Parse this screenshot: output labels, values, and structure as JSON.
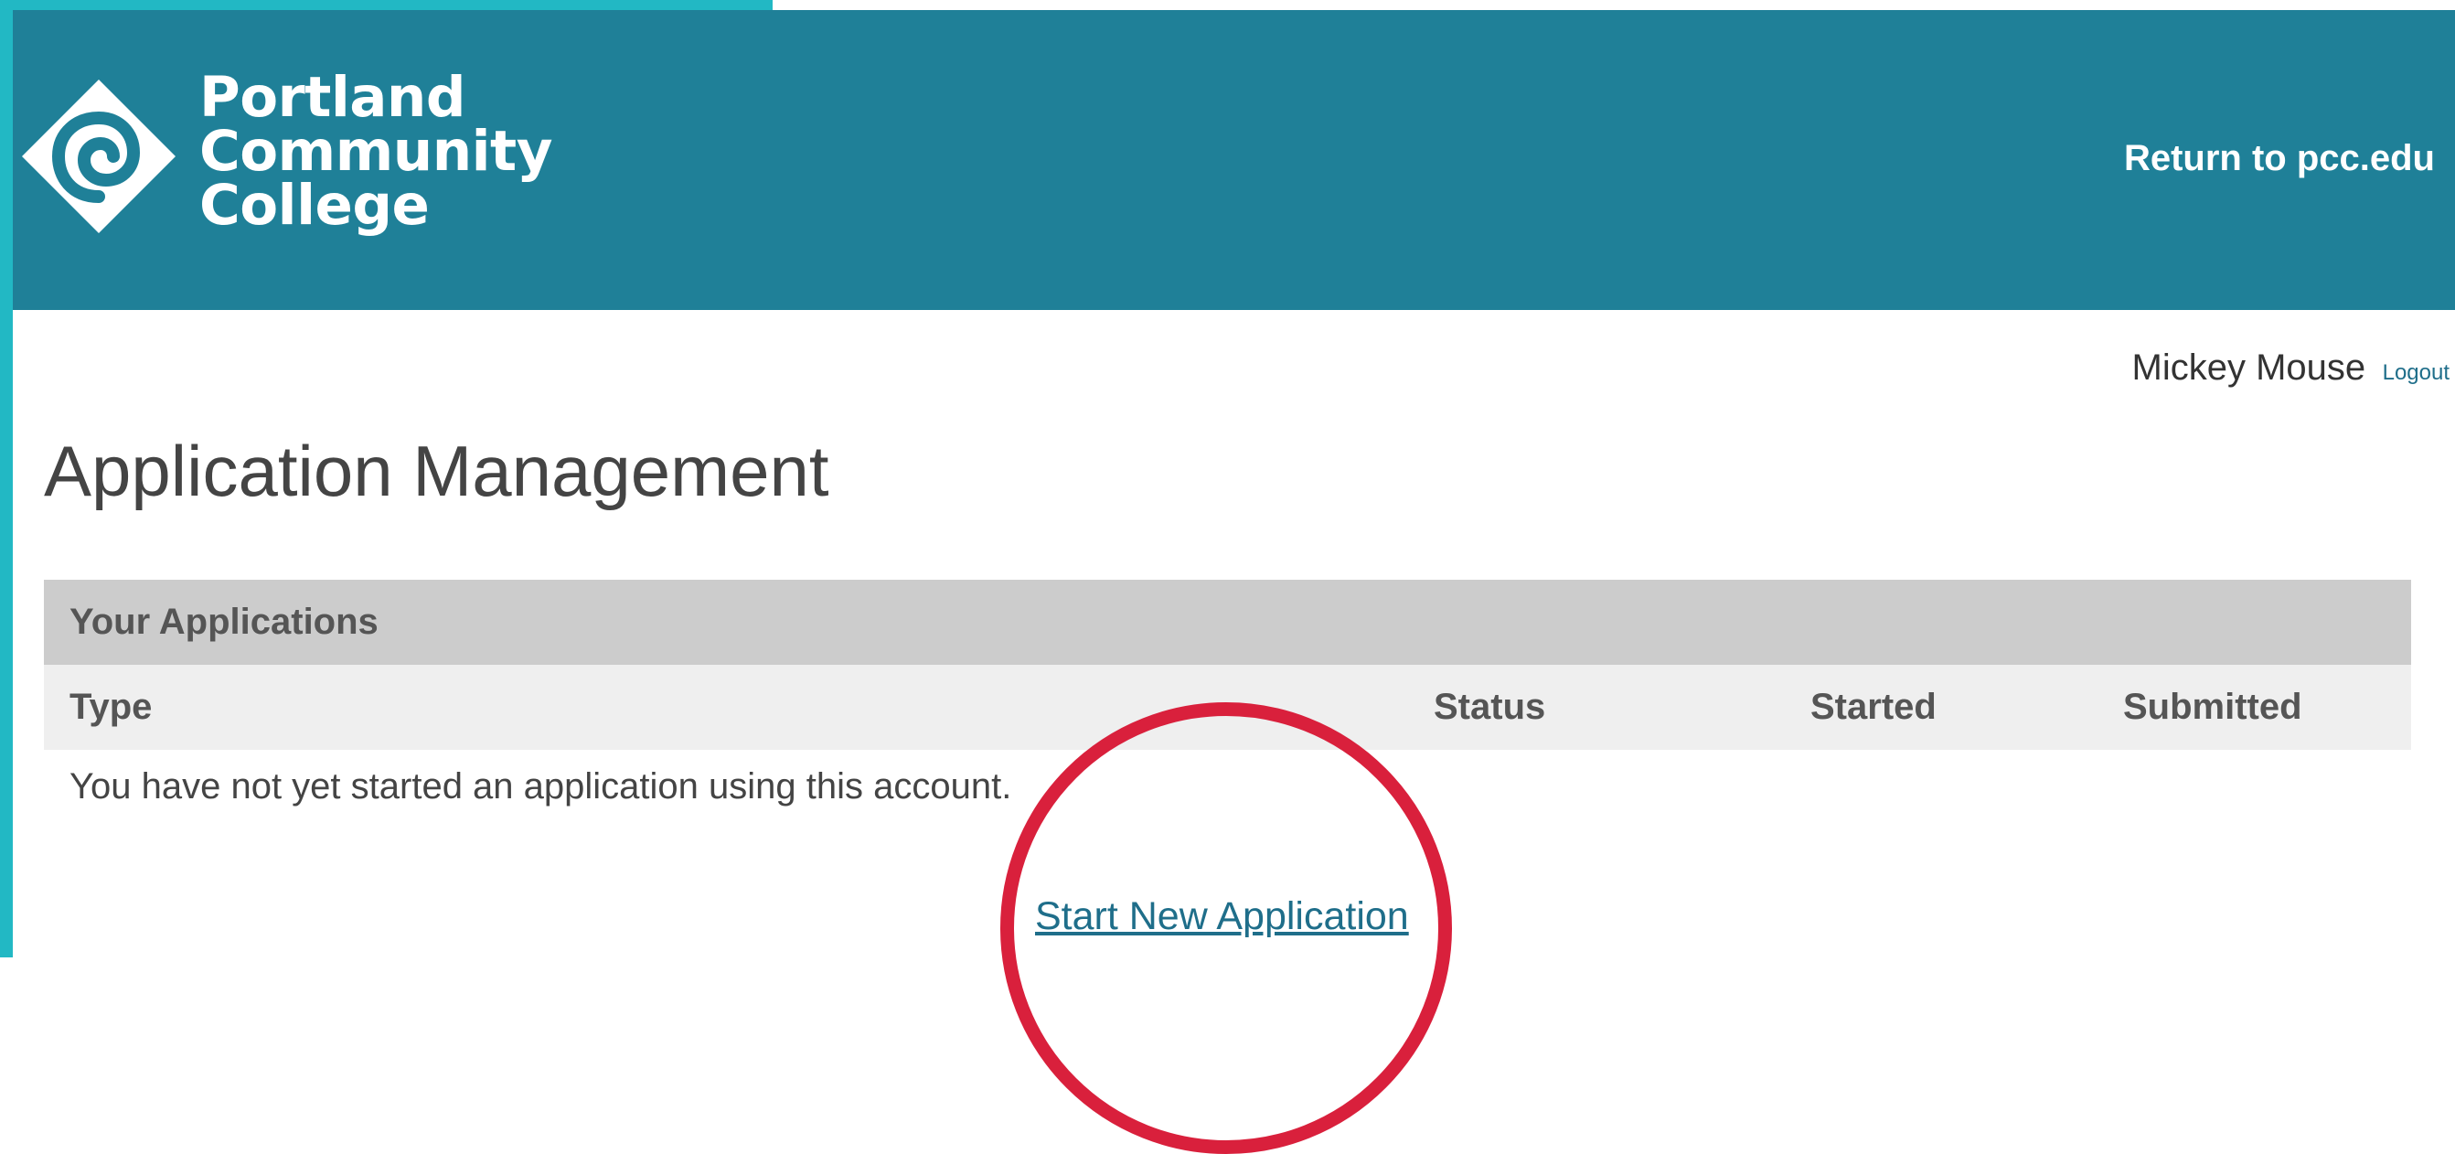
{
  "header": {
    "logo_lines": [
      "Portland",
      "Community",
      "College"
    ],
    "logo_icon": "spiral-diamond-icon",
    "return_link": "Return to pcc.edu"
  },
  "user": {
    "name": "Mickey Mouse",
    "logout_label": "Logout"
  },
  "page": {
    "title": "Application Management"
  },
  "applications": {
    "panel_title": "Your Applications",
    "columns": [
      "Type",
      "Status",
      "Started",
      "Submitted"
    ],
    "empty_message": "You have not yet started an application using this account.",
    "start_link": "Start New Application"
  },
  "colors": {
    "header_bg": "#1f8098",
    "accent_strip": "#22b8c4",
    "link": "#1f6e8a",
    "highlight": "#d9203c"
  }
}
